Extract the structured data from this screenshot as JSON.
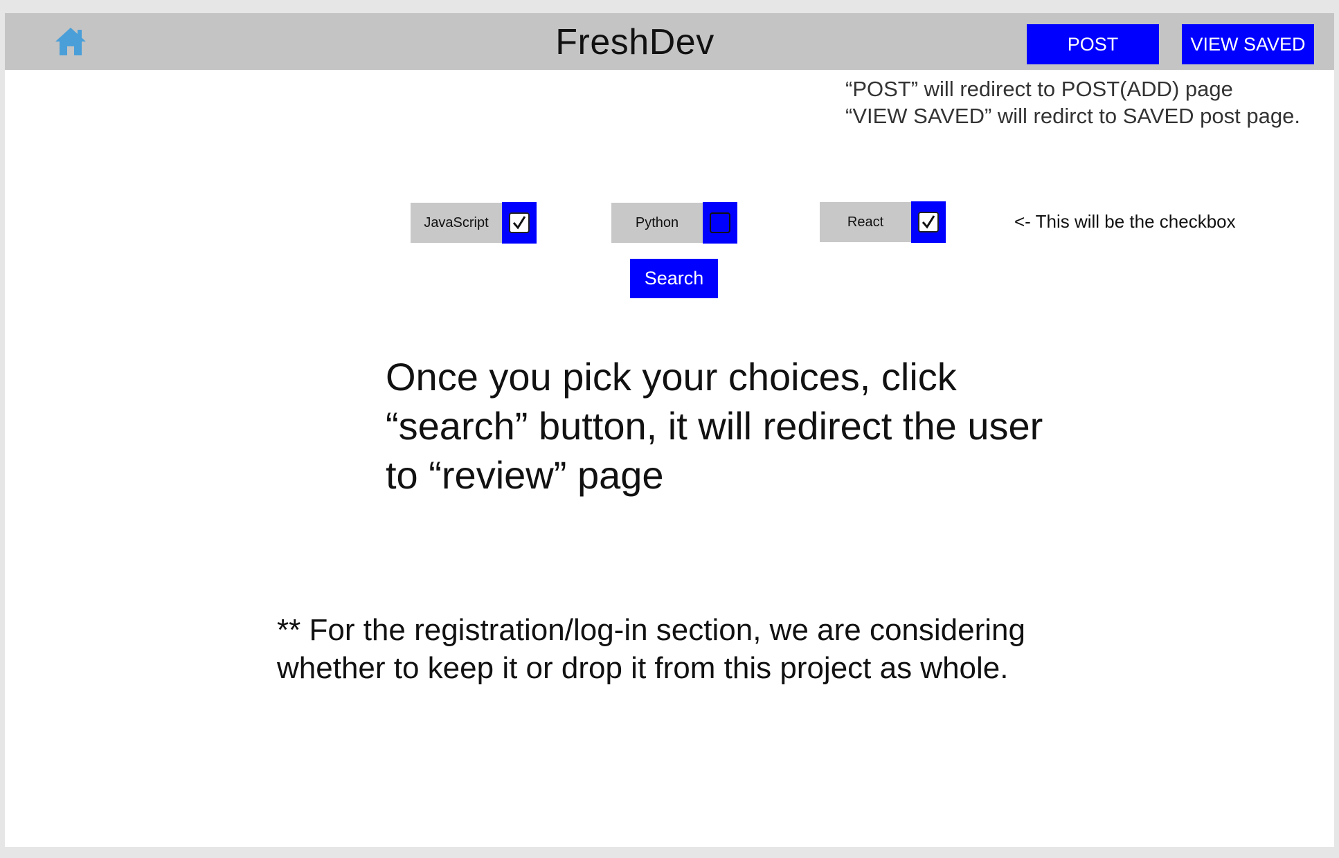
{
  "header": {
    "title": "FreshDev",
    "post_label": "POST",
    "view_saved_label": "VIEW SAVED",
    "home_icon": "home-icon",
    "home_icon_color": "#4a9fd8"
  },
  "annotations": {
    "nav_note_line1": "“POST” will redirect to POST(ADD) page",
    "nav_note_line2": "“VIEW SAVED” will redirct to SAVED post page.",
    "checkbox_note": "<- This will be the checkbox",
    "search_note": "Once you pick your choices, click “search” button, it will redirect the user to “review” page",
    "footer_note": "** For the registration/log-in section, we are considering whether to keep it or drop it from this project as whole."
  },
  "filters": [
    {
      "label": "JavaScript",
      "checked": true
    },
    {
      "label": "Python",
      "checked": false
    },
    {
      "label": "React",
      "checked": true
    }
  ],
  "search_label": "Search",
  "colors": {
    "accent": "#0000ff",
    "header_bg": "#c4c4c4",
    "chip_bg": "#c8c8c8"
  }
}
